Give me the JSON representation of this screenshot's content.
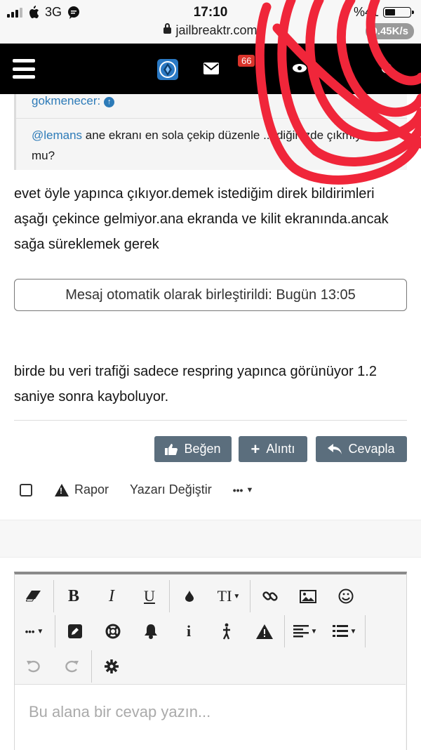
{
  "status_bar": {
    "carrier": "3G",
    "time": "17:10",
    "battery_text": "%41",
    "battery_level": 0.41,
    "url": "jailbreaktr.com",
    "speed": "0.45K/s"
  },
  "nav": {
    "badge": "66"
  },
  "quote": {
    "author": "gokmenecer:",
    "mention": "@lemans",
    "text": " ane ekranı en sola çekip düzenle ...tdiğinizde çıkmıyor mu?"
  },
  "post": {
    "paragraph1": "evet öyle yapınca çıkıyor.demek istediğim direk bildirimleri aşağı çekince gelmiyor.ana ekranda ve kilit ekranında.ancak sağa süreklemek gerek",
    "merged_notice": "Mesaj otomatik olarak birleştirildi: Bugün 13:05",
    "paragraph2": "birde bu veri trafiği sadece respring yapınca görünüyor 1.2 saniye sonra kayboluyor."
  },
  "buttons": {
    "like": "Beğen",
    "quote": "Alıntı",
    "reply": "Cevapla"
  },
  "actions": {
    "report": "Rapor",
    "change_author": "Yazarı Değiştir",
    "more": "•••"
  },
  "editor": {
    "placeholder": "Bu alana bir cevap yazın...",
    "bold": "B",
    "italic": "I",
    "underline": "U",
    "font_size": "TI",
    "info": "i",
    "more": "•••"
  },
  "colors": {
    "link": "#2d7bb8",
    "button_bg": "#5b6e7d",
    "badge": "#d9342b",
    "scribble": "#f0263a"
  }
}
